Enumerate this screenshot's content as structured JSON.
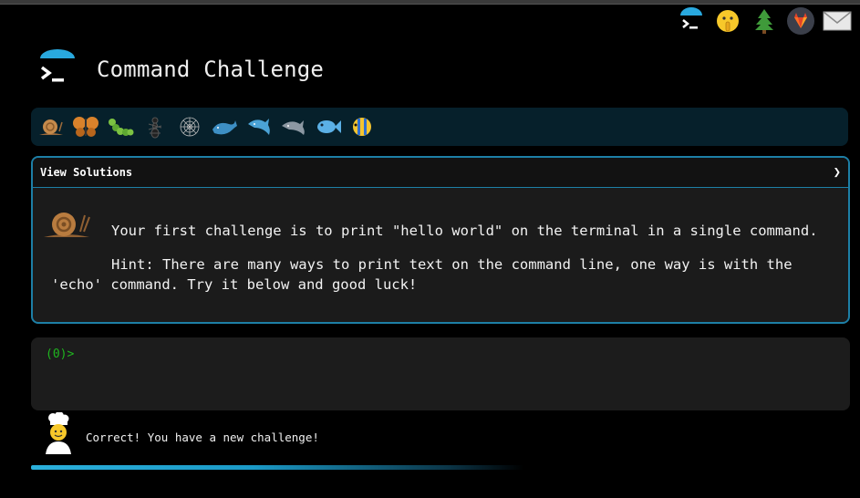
{
  "header": {
    "title": "Command Challenge"
  },
  "top_icons": [
    {
      "name": "terminal-logo-icon"
    },
    {
      "name": "shush-face-icon"
    },
    {
      "name": "tree-icon"
    },
    {
      "name": "gitlab-icon"
    },
    {
      "name": "mail-icon"
    }
  ],
  "levels": [
    {
      "name": "snail-icon"
    },
    {
      "name": "butterfly-icon"
    },
    {
      "name": "caterpillar-icon"
    },
    {
      "name": "ant-icon"
    },
    {
      "name": "spider-web-icon"
    },
    {
      "name": "whale-icon"
    },
    {
      "name": "dolphin-icon"
    },
    {
      "name": "dolphin-gray-icon"
    },
    {
      "name": "fish-icon"
    },
    {
      "name": "tropical-fish-icon"
    }
  ],
  "solutions": {
    "label": "View Solutions",
    "toggle": "❯"
  },
  "challenge": {
    "text": "Your first challenge is to print \"hello world\" on the terminal in a single command.",
    "hint": "Hint: There are many ways to print text on the command line, one way is with the 'echo' command. Try it below and good luck!"
  },
  "terminal": {
    "prompt": "(0)>"
  },
  "status": {
    "message": "Correct! You have a new challenge!"
  },
  "colors": {
    "accent": "#1d7fa6",
    "prompt": "#1fb51f",
    "background": "#000000"
  }
}
